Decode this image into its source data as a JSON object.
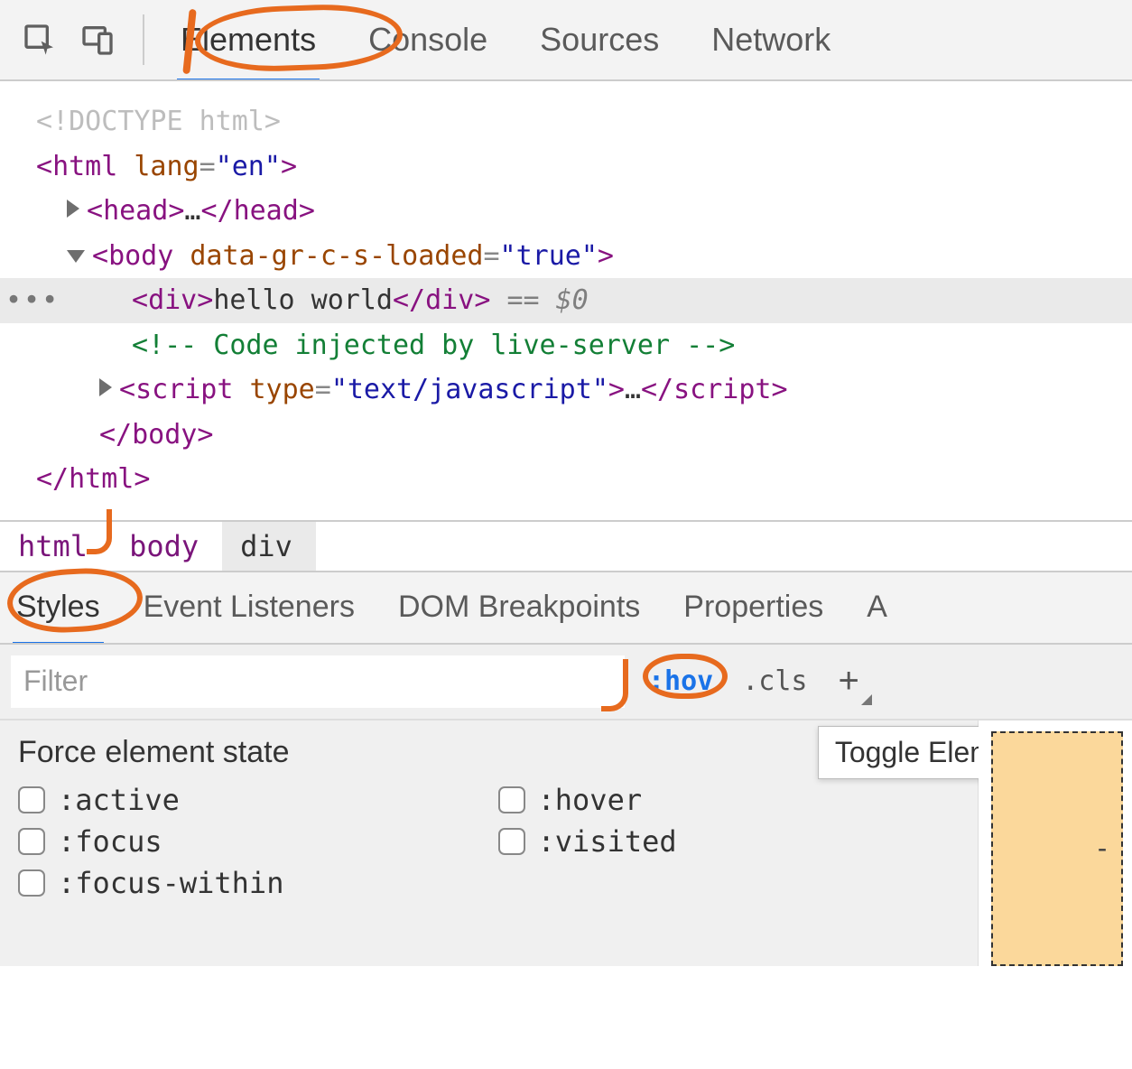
{
  "toolbar": {
    "tabs": [
      "Elements",
      "Console",
      "Sources",
      "Network"
    ],
    "activeIndex": 0
  },
  "dom": {
    "doctype": "<!DOCTYPE html>",
    "htmlOpen": {
      "tag": "html",
      "attrName": "lang",
      "attrValue": "en"
    },
    "head": {
      "tag": "head",
      "collapsedContent": "…"
    },
    "bodyOpen": {
      "tag": "body",
      "attrName": "data-gr-c-s-loaded",
      "attrValue": "true"
    },
    "selectedDiv": {
      "tag": "div",
      "text": "hello world",
      "suffix": "== $0"
    },
    "comment": "<!-- Code injected by live-server -->",
    "script": {
      "tag": "script",
      "attrName": "type",
      "attrValue": "text/javascript",
      "collapsedContent": "…"
    },
    "bodyClose": "body",
    "htmlClose": "html"
  },
  "breadcrumb": {
    "items": [
      "html",
      "body",
      "div"
    ],
    "selectedIndex": 2
  },
  "subtabs": {
    "items": [
      "Styles",
      "Event Listeners",
      "DOM Breakpoints",
      "Properties",
      "A"
    ],
    "activeIndex": 0
  },
  "stylesHeader": {
    "filterPlaceholder": "Filter",
    "hovLabel": ":hov",
    "clsLabel": ".cls",
    "tooltip": "Toggle Element State"
  },
  "forceState": {
    "title": "Force element state",
    "options": [
      ":active",
      ":hover",
      ":focus",
      ":visited",
      ":focus-within"
    ]
  },
  "boxModel": {
    "dashLabel": "-"
  }
}
